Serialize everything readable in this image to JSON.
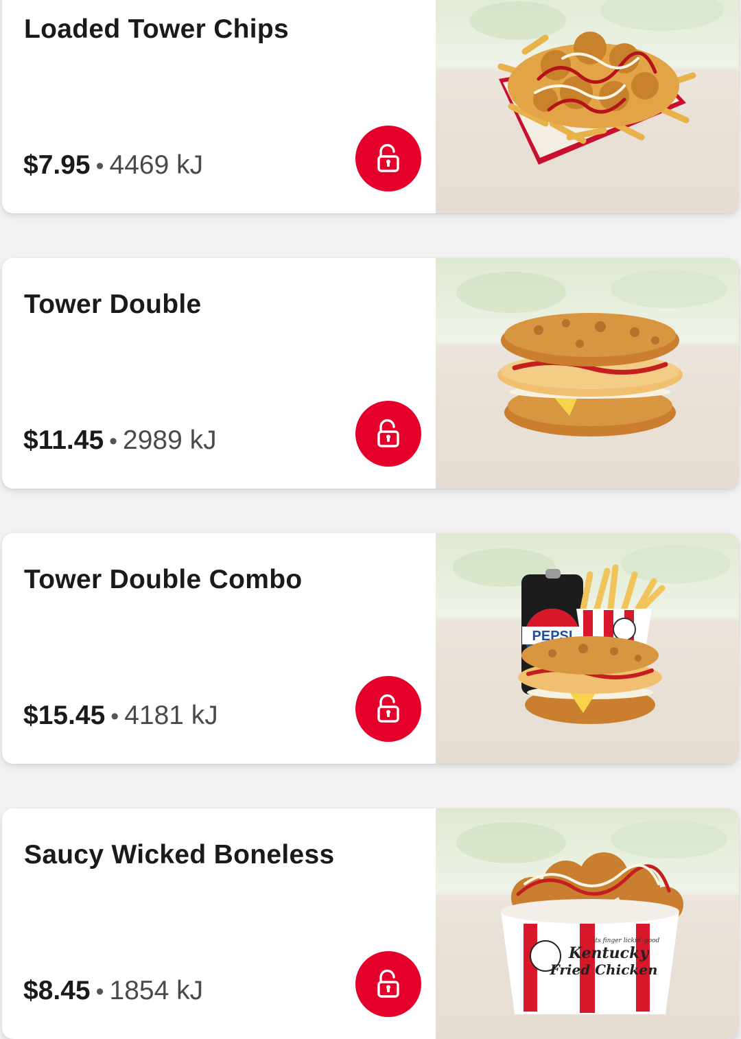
{
  "colors": {
    "accent_red": "#e4002b",
    "text_primary": "#1a1a1a",
    "text_secondary": "#4a4a4a",
    "background": "#f2f2f2",
    "card": "#ffffff"
  },
  "menu_items": [
    {
      "name": "Loaded Tower Chips",
      "price": "$7.95",
      "separator": "•",
      "energy": "4469 kJ",
      "icon": "unlock-icon",
      "image": "loaded-tower-chips-image"
    },
    {
      "name": "Tower Double",
      "price": "$11.45",
      "separator": "•",
      "energy": "2989 kJ",
      "icon": "unlock-icon",
      "image": "tower-double-image"
    },
    {
      "name": "Tower Double Combo",
      "price": "$15.45",
      "separator": "•",
      "energy": "4181 kJ",
      "icon": "unlock-icon",
      "image": "tower-double-combo-image",
      "image_text": {
        "can_brand": "PEPSI"
      }
    },
    {
      "name": "Saucy Wicked Boneless",
      "price": "$8.45",
      "separator": "•",
      "energy": "1854 kJ",
      "icon": "unlock-icon",
      "image": "saucy-wicked-boneless-image",
      "image_text": {
        "bucket_brand_line1": "Kentucky",
        "bucket_brand_line2": "Fried Chicken",
        "bucket_tagline": "its finger lickin' good"
      }
    }
  ]
}
